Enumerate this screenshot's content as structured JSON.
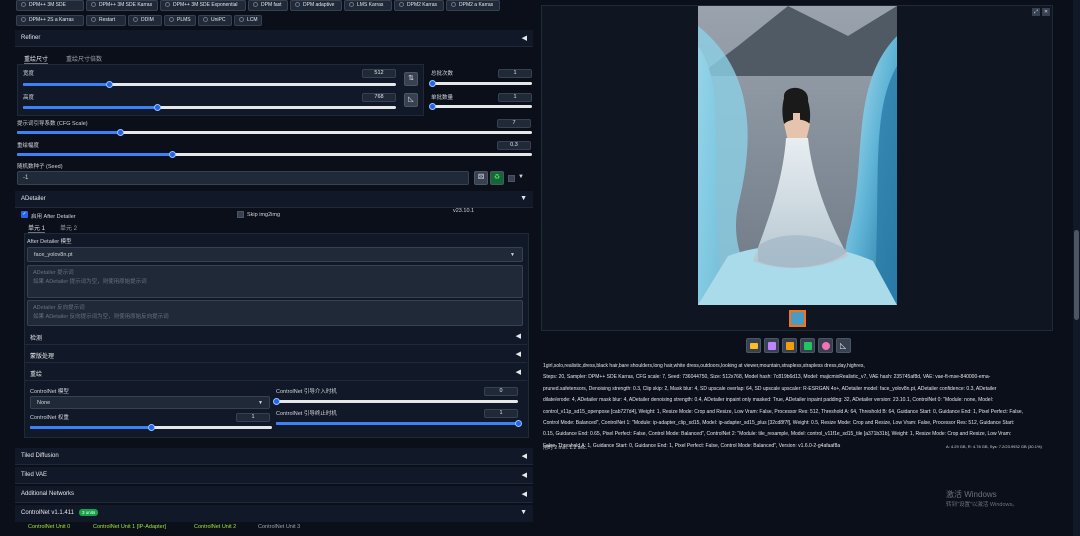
{
  "samplers": {
    "row1": [
      "DPM++ 3M SDE",
      "DPM++ 3M SDE Karras",
      "DPM++ 3M SDE Exponential",
      "DPM fast",
      "DPM adaptive",
      "LMS Karras",
      "DPM2 Karras",
      "DPM2 a Karras"
    ],
    "row2": [
      "DPM++ 2S a Karras",
      "Restart",
      "DDIM",
      "PLMS",
      "UniPC",
      "LCM"
    ]
  },
  "refiner": {
    "label": "Refiner"
  },
  "size_tabs": [
    "重绘尺寸",
    "重绘尺寸倍数"
  ],
  "width": {
    "label": "宽度",
    "value": "512",
    "fraction": 0.23
  },
  "height": {
    "label": "高度",
    "value": "768",
    "fraction": 0.36
  },
  "batch_count": {
    "label": "总批次数",
    "value": "1",
    "fraction": 0.0
  },
  "batch_size": {
    "label": "单批数量",
    "value": "1",
    "fraction": 0.0
  },
  "cfg": {
    "label": "提示词引导系数 (CFG Scale)",
    "value": "7",
    "fraction": 0.2
  },
  "denoise": {
    "label": "重绘幅度",
    "value": "0.3",
    "fraction": 0.3
  },
  "seed": {
    "label": "随机数种子 (Seed)",
    "value": "-1"
  },
  "adetailer": {
    "title": "ADetailer",
    "enable_label": "启用 After Detailer",
    "skip_label": "Skip img2img",
    "version": "v23.10.1",
    "unit_tabs": [
      "单元 1",
      "单元 2"
    ],
    "model_label": "After Detailer 模型",
    "model_value": "face_yolov8n.pt",
    "prompt_placeholder": "ADetailer 提示词\n如果 ADetailer 提示词为空，则使用原始提示词",
    "neg_placeholder": "ADetailer 反向提示词\n如果 ADetailer 反向提示词为空，则使用原始反向提示词",
    "sections": [
      "检测",
      "蒙版处理",
      "重绘"
    ],
    "controlnet_model_label": "ControlNet 模型",
    "controlnet_model_value": "None",
    "controlnet_weight": {
      "label": "ControlNet 权重",
      "value": "1",
      "fraction": 0.5
    },
    "controlnet_start": {
      "label": "ControlNet 引导介入时机",
      "value": "0",
      "fraction": 0.0
    },
    "controlnet_end": {
      "label": "ControlNet 引导终止时机",
      "value": "1",
      "fraction": 1.0
    }
  },
  "accordions": [
    "Tiled Diffusion",
    "Tiled VAE",
    "Additional Networks"
  ],
  "controlnet": {
    "title": "ControlNet v1.1.411",
    "badge": "3 units",
    "units": [
      "ControlNet Unit 0",
      "ControlNet Unit 1 [IP-Adapter]",
      "ControlNet Unit 2",
      "ControlNet Unit 3"
    ]
  },
  "generation_info": {
    "prompt": "1girl,solo,realistic,dress,black hair,bare shoulders,long hair,white dress,outdoors,looking at viewer,mountain,strapless,strapless dress,day,highres,",
    "params": "Steps: 20, Sampler: DPM++ SDE Karras, CFG scale: 7, Seed: 736044750, Size: 512x768, Model hash: 7c819b6d13, Model: majicmixRealistic_v7, VAE hash: 235745af8d, VAE: vae-ft-mse-840000-ema-pruned.safetensors, Denoising strength: 0.3, Clip skip: 2, Mask blur: 4, SD upscale overlap: 64, SD upscale upscaler: R-ESRGAN 4x+, ADetailer model: face_yolov8n.pt, ADetailer confidence: 0.3, ADetailer dilate/erode: 4, ADetailer mask blur: 4, ADetailer denoising strength: 0.4, ADetailer inpaint only masked: True, ADetailer inpaint padding: 32, ADetailer version: 23.10.1, ControlNet 0: \"Module: none, Model: control_v11p_sd15_openpose [cab727d4], Weight: 1, Resize Mode: Crop and Resize, Low Vram: False, Processor Res: 512, Threshold A: 64, Threshold B: 64, Guidance Start: 0, Guidance End: 1, Pixel Perfect: False, Control Mode: Balanced\", ControlNet 1: \"Module: ip-adapter_clip_sd15, Model: ip-adapter_sd15_plus [32cd8f7f], Weight: 0.5, Resize Mode: Crop and Resize, Low Vram: False, Processor Res: 512, Guidance Start: 0.15, Guidance End: 0.65, Pixel Perfect: False, Control Mode: Balanced\", ControlNet 2: \"Module: tile_resample, Model: control_v11f1e_sd15_tile [a371b31b], Weight: 1, Resize Mode: Crop and Resize, Low Vram: False, Threshold A: 1, Guidance Start: 0, Guidance End: 1, Pixel Perfect: False, Control Mode: Balanced\", Version: v1.6.0-2-g4afaaf8a",
    "time": "用时 2 min. 1.2 sec.",
    "vram": "A: 4.29 GB, R: 4.78 GB, Sys: 7.2/23.9932 GB (30.1%)"
  },
  "windows": {
    "line1": "激活 Windows",
    "line2": "转到\"设置\"以激活 Windows。"
  },
  "colors": {
    "bg": "#0b0f19",
    "accent": "#3b82f6",
    "green": "#4ade80"
  },
  "image_toolbar_icons": [
    "folder-icon",
    "save-icon",
    "archive-icon",
    "image-icon",
    "palette-icon",
    "ruler-icon"
  ]
}
